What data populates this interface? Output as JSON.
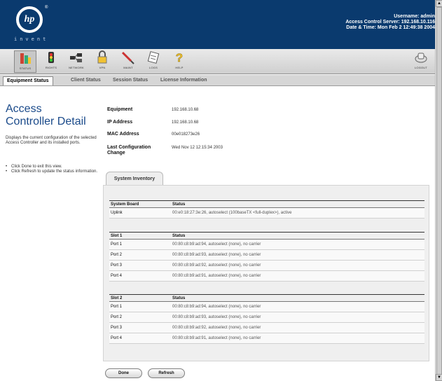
{
  "header": {
    "logo_text": "hp",
    "logo_tagline": "invent",
    "username_label": "Username:",
    "username": "admin",
    "server_label": "Access Control Server:",
    "server": "192.168.10.116",
    "datetime_label": "Date & Time:",
    "datetime": "Mon Feb 2 12:49:38 2004"
  },
  "toolbar": {
    "items": [
      {
        "label": "STATUS",
        "icon": "status-icon"
      },
      {
        "label": "RIGHTS",
        "icon": "rights-icon"
      },
      {
        "label": "NETWORK",
        "icon": "network-icon"
      },
      {
        "label": "VPN",
        "icon": "vpn-icon"
      },
      {
        "label": "MAINT",
        "icon": "maint-icon"
      },
      {
        "label": "LOGS",
        "icon": "logs-icon"
      },
      {
        "label": "HELP",
        "icon": "help-icon"
      }
    ],
    "logout": "LOGOUT"
  },
  "tabs": [
    {
      "label": "Equipment Status"
    },
    {
      "label": "Client Status"
    },
    {
      "label": "Session Status"
    },
    {
      "label": "License Information"
    }
  ],
  "left": {
    "title_line1": "Access",
    "title_line2": "Controller Detail",
    "description": "Displays the current configuration of the selected Access Controller and its installed ports.",
    "tip1": "Click Done to exit this view.",
    "tip2": "Click Refresh to update the status information."
  },
  "details": {
    "equipment_label": "Equipment",
    "equipment": "192.168.10.68",
    "ip_label": "IP Address",
    "ip": "192.168.10.68",
    "mac_label": "MAC Address",
    "mac": "00e018273e26",
    "lastcfg_label": "Last Configuration Change",
    "lastcfg": "Wed Nov 12 12:15:34 2003"
  },
  "inventory": {
    "tab_label": "System Inventory",
    "board": {
      "header": [
        "System Board",
        "Status"
      ],
      "rows": [
        [
          "Uplink",
          "00:e0:18:27:3e:26, autoselect (100baseTX <full-duplex>), active"
        ]
      ]
    },
    "slot1": {
      "header": [
        "Slot 1",
        "Status"
      ],
      "rows": [
        [
          "Port 1",
          "00:80:c8:b9:ad:94, autoselect (none), no carrier"
        ],
        [
          "Port 2",
          "00:80:c8:b9:ad:93, autoselect (none), no carrier"
        ],
        [
          "Port 3",
          "00:80:c8:b9:ad:92, autoselect (none), no carrier"
        ],
        [
          "Port 4",
          "00:80:c8:b9:ad:91, autoselect (none), no carrier"
        ]
      ]
    },
    "slot2": {
      "header": [
        "Slot 2",
        "Status"
      ],
      "rows": [
        [
          "Port 1",
          "00:80:c8:b9:ad:94, autoselect (none), no carrier"
        ],
        [
          "Port 2",
          "00:80:c8:b9:ad:93, autoselect (none), no carrier"
        ],
        [
          "Port 3",
          "00:80:c8:b9:ad:92, autoselect (none), no carrier"
        ],
        [
          "Port 4",
          "00:80:c8:b9:ad:91, autoselect (none), no carrier"
        ]
      ]
    }
  },
  "buttons": {
    "done": "Done",
    "refresh": "Refresh"
  }
}
